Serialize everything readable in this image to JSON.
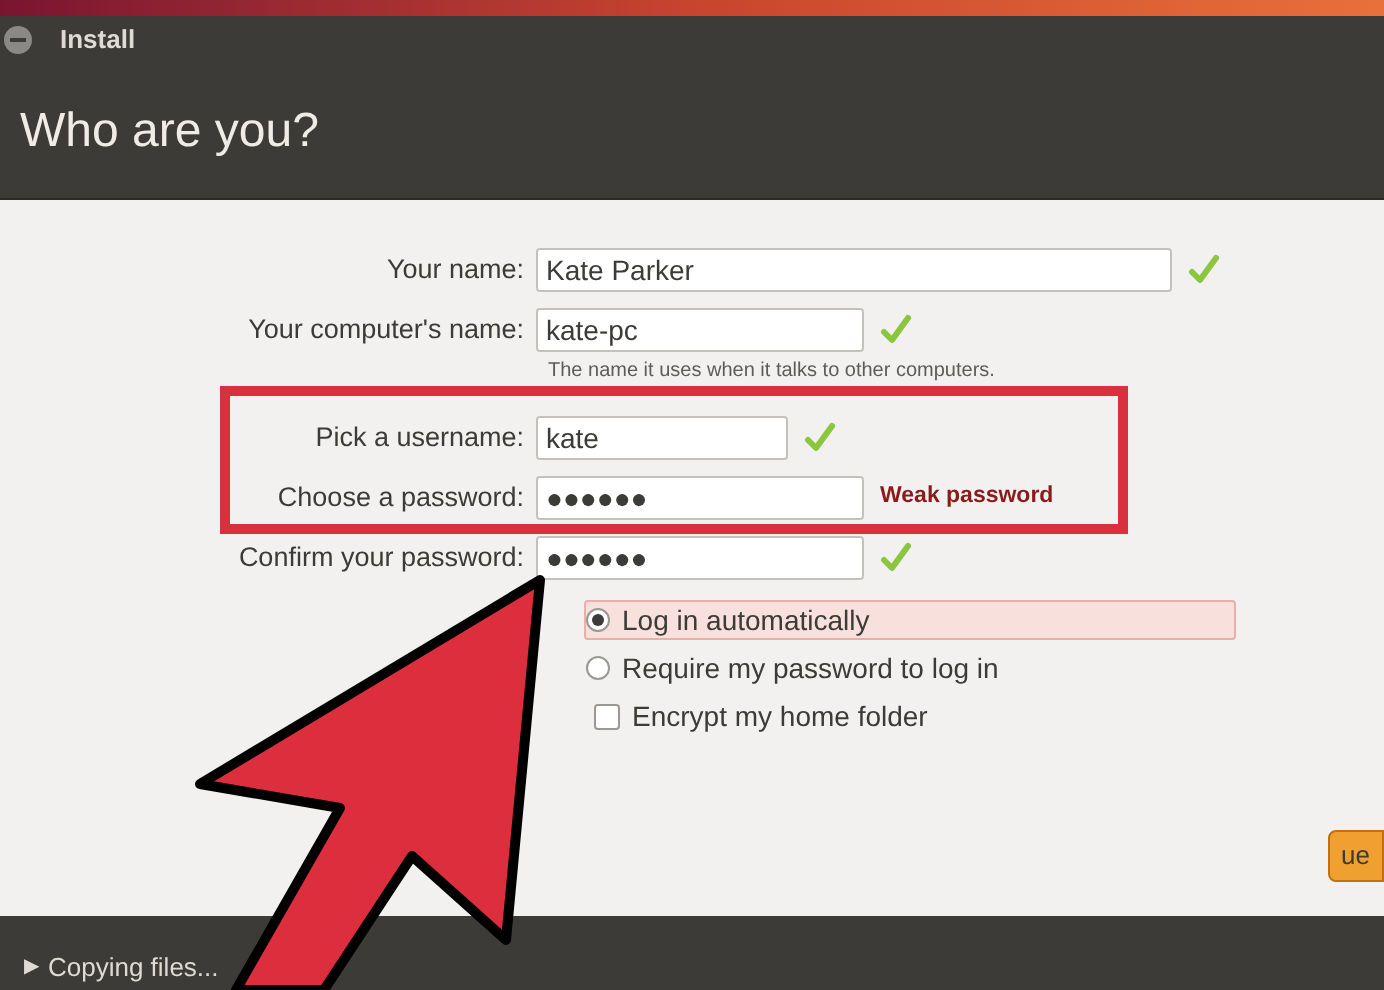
{
  "window": {
    "title": "Install"
  },
  "heading": "Who are you?",
  "fields": [
    {
      "label": "Your name:",
      "value": "Kate Parker",
      "valid": true
    },
    {
      "label": "Your computer's name:",
      "value": "kate-pc",
      "valid": true,
      "hint": "The name it uses when it talks to other computers."
    },
    {
      "label": "Pick a username:",
      "value": "kate",
      "valid": true
    },
    {
      "label": "Choose a password:",
      "value": "●●●●●●",
      "valid": false,
      "warning": "Weak password"
    },
    {
      "label": "Confirm your password:",
      "value": "●●●●●●",
      "valid": true
    }
  ],
  "login_options": [
    {
      "kind": "radio",
      "label": "Log in automatically",
      "selected": true
    },
    {
      "kind": "radio",
      "label": "Require my password to log in",
      "selected": false
    },
    {
      "kind": "checkbox",
      "label": "Encrypt my home folder",
      "checked": false
    }
  ],
  "continue_button": "ue",
  "status_bar": {
    "icon": "▶",
    "text": "Copying files..."
  }
}
